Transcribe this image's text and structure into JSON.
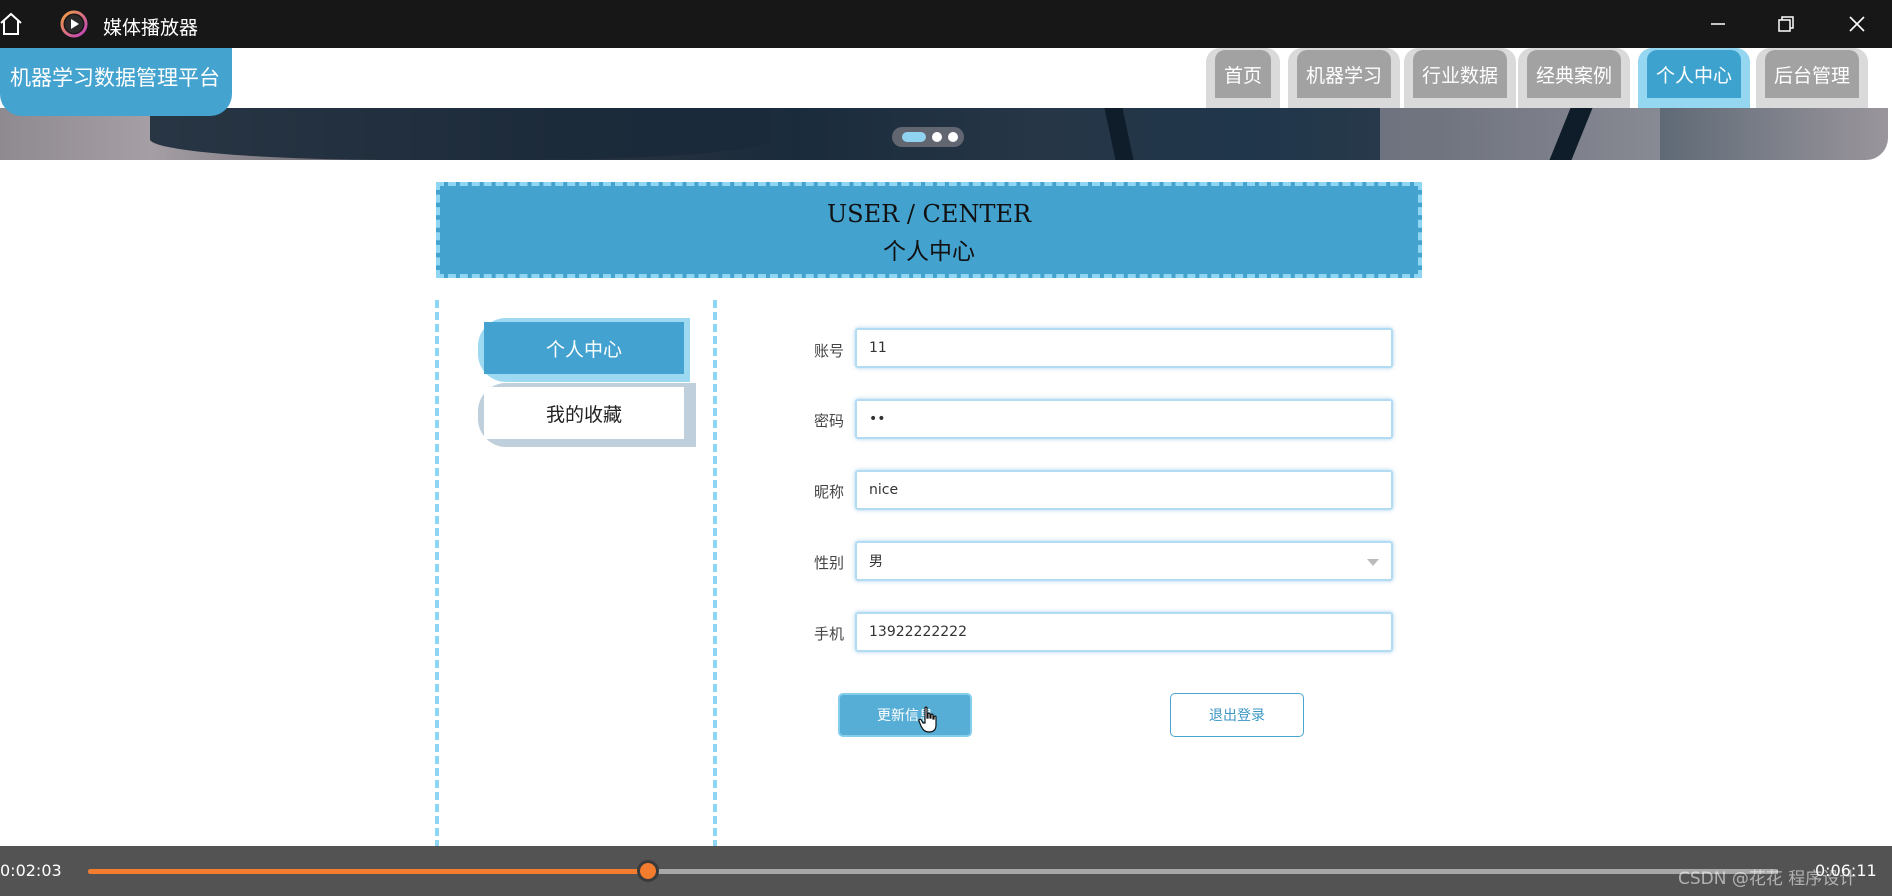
{
  "window": {
    "title": "媒体播放器"
  },
  "header": {
    "logo": "机器学习数据管理平台",
    "nav": [
      {
        "label": "首页",
        "active": false
      },
      {
        "label": "机器学习",
        "active": false
      },
      {
        "label": "行业数据",
        "active": false
      },
      {
        "label": "经典案例",
        "active": false
      },
      {
        "label": "个人中心",
        "active": true
      },
      {
        "label": "后台管理",
        "active": false
      }
    ]
  },
  "banner": {
    "slides": 3,
    "active_slide": 1
  },
  "section": {
    "title_en": "USER / CENTER",
    "title_cn": "个人中心"
  },
  "sidebar": {
    "items": [
      {
        "label": "个人中心",
        "active": true
      },
      {
        "label": "我的收藏",
        "active": false
      }
    ]
  },
  "form": {
    "fields": [
      {
        "label": "账号",
        "value": "11"
      },
      {
        "label": "密码",
        "value": "••"
      },
      {
        "label": "昵称",
        "value": "nice"
      },
      {
        "label": "性别",
        "value": "男"
      },
      {
        "label": "手机",
        "value": "13922222222"
      }
    ],
    "update_button": "更新信息",
    "logout_button": "退出登录"
  },
  "player": {
    "current_time": "0:02:03",
    "total_time": "0:06:11",
    "progress": 0.3315,
    "watermark": "CSDN @花花 程序设计"
  },
  "colors": {
    "accent": "#44a3cf",
    "accent_light": "#8fd6f4",
    "nav_inactive": "#a2a2a2",
    "progress": "#f47c2e"
  }
}
